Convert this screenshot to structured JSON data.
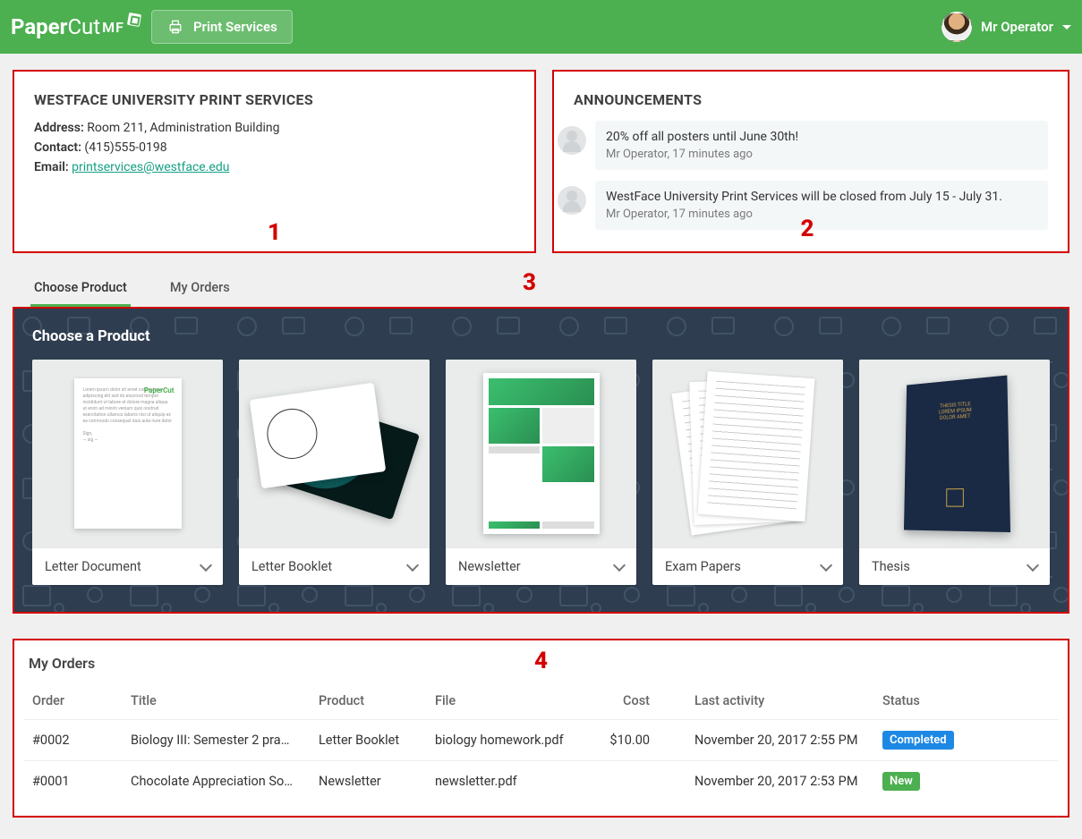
{
  "header": {
    "app_name": "PaperCutMF",
    "nav_button": "Print Services",
    "user_name": "Mr Operator"
  },
  "info_panel": {
    "title": "WESTFACE UNIVERSITY PRINT SERVICES",
    "address_label": "Address:",
    "address_value": "Room 211, Administration Building",
    "contact_label": "Contact:",
    "contact_value": "(415)555-0198",
    "email_label": "Email:",
    "email_value": "printservices@westface.edu"
  },
  "announcements": {
    "title": "ANNOUNCEMENTS",
    "items": [
      {
        "text": "20% off all posters until June 30th!",
        "meta": "Mr Operator, 17 minutes ago"
      },
      {
        "text": "WestFace University Print Services will be closed from July 15 - July 31.",
        "meta": "Mr Operator, 17 minutes ago"
      }
    ]
  },
  "hotspots": {
    "h1": "1",
    "h2": "2",
    "h3": "3",
    "h4": "4"
  },
  "tabs": {
    "choose_product": "Choose Product",
    "my_orders": "My Orders"
  },
  "products": {
    "title": "Choose a Product",
    "items": [
      {
        "label": "Letter Document"
      },
      {
        "label": "Letter Booklet"
      },
      {
        "label": "Newsletter"
      },
      {
        "label": "Exam Papers"
      },
      {
        "label": "Thesis"
      }
    ]
  },
  "orders": {
    "title": "My Orders",
    "columns": {
      "order": "Order",
      "title": "Title",
      "product": "Product",
      "file": "File",
      "cost": "Cost",
      "last_activity": "Last activity",
      "status": "Status"
    },
    "rows": [
      {
        "order": "#0002",
        "title": "Biology III: Semester 2 pra…",
        "product": "Letter Booklet",
        "file": "biology homework.pdf",
        "cost": "$10.00",
        "last_activity": "November 20, 2017 2:55 PM",
        "status": "Completed",
        "status_class": "completed"
      },
      {
        "order": "#0001",
        "title": "Chocolate Appreciation So…",
        "product": "Newsletter",
        "file": "newsletter.pdf",
        "cost": "",
        "last_activity": "November 20, 2017 2:53 PM",
        "status": "New",
        "status_class": "new"
      }
    ]
  }
}
